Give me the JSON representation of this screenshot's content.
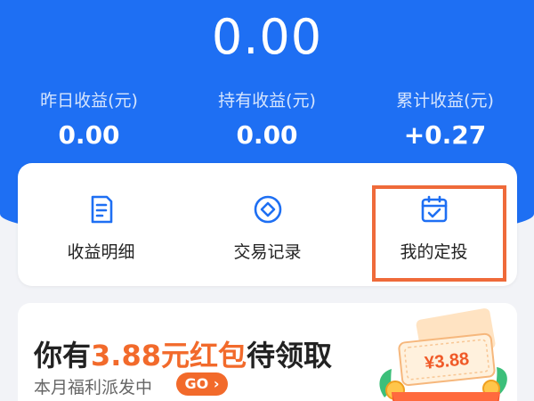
{
  "summary": {
    "total_value": "0.00",
    "stats": [
      {
        "label": "昨日收益(元)",
        "value": "0.00"
      },
      {
        "label": "持有收益(元)",
        "value": "0.00"
      },
      {
        "label": "累计收益(元)",
        "value": "+0.27"
      }
    ]
  },
  "actions": [
    {
      "label": "收益明细",
      "icon": "document-icon"
    },
    {
      "label": "交易记录",
      "icon": "diamond-icon"
    },
    {
      "label": "我的定投",
      "icon": "calendar-check-icon"
    }
  ],
  "promo": {
    "headline_prefix": "你有",
    "headline_amount": "3.88元红包",
    "headline_suffix": "待领取",
    "subtitle": "本月福利派发中",
    "go_label": "GO",
    "coupon_amount": "¥3.88"
  },
  "colors": {
    "primary": "#1e6ff3",
    "accent": "#f26a2b",
    "highlight_border": "#ef6a3a"
  }
}
